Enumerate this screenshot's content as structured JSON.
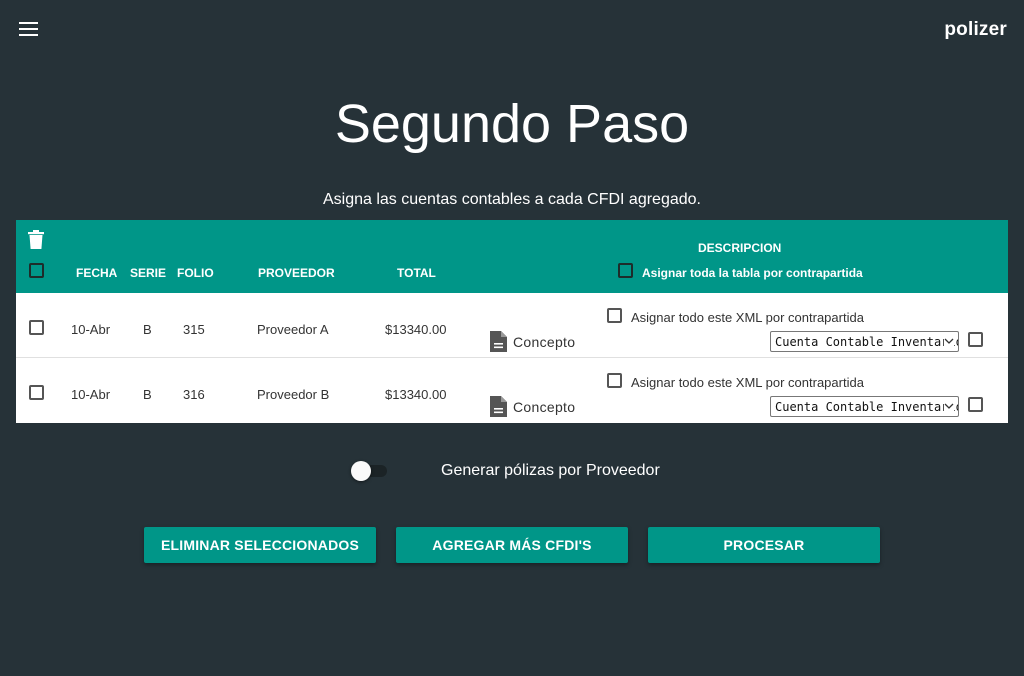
{
  "app": {
    "brand": "polizer"
  },
  "page": {
    "title": "Segundo Paso",
    "subtitle": "Asigna las cuentas contables a cada CFDI agregado."
  },
  "table": {
    "headers": {
      "fecha": "FECHA",
      "serie": "SERIE",
      "folio": "FOLIO",
      "proveedor": "PROVEEDOR",
      "total": "TOTAL",
      "descripcion": "DESCRIPCION",
      "assign_all": "Asignar toda la tabla por contrapartida"
    },
    "rows": [
      {
        "fecha": "10-Abr",
        "serie": "B",
        "folio": "315",
        "proveedor": "Proveedor A",
        "total": "$13340.00",
        "concepto": "Concepto",
        "assign_xml": "Asignar todo este XML por contrapartida",
        "cuenta": "Cuenta Contable Inventario"
      },
      {
        "fecha": "10-Abr",
        "serie": "B",
        "folio": "316",
        "proveedor": "Proveedor B",
        "total": "$13340.00",
        "concepto": "Concepto",
        "assign_xml": "Asignar todo este XML por contrapartida",
        "cuenta": "Cuenta Contable Inventario"
      }
    ]
  },
  "toggle": {
    "label": "Generar pólizas por Proveedor",
    "on": false
  },
  "buttons": {
    "eliminar": "ELIMINAR SELECCIONADOS",
    "agregar": "AGREGAR MÁS CFDI'S",
    "procesar": "PROCESAR"
  },
  "colors": {
    "background": "#263238",
    "accent": "#009688",
    "text": "#ffffff"
  },
  "icons": [
    "menu-icon",
    "trash-icon",
    "document-icon",
    "chevron-down-icon"
  ]
}
